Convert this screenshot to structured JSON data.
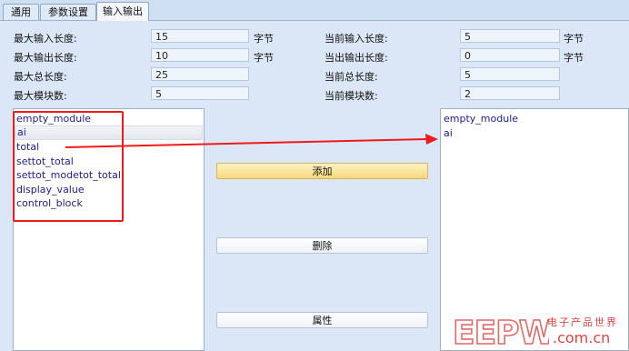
{
  "tabs": [
    {
      "label": "通用"
    },
    {
      "label": "参数设置"
    },
    {
      "label": "输入输出"
    }
  ],
  "fields": {
    "max_input_len": {
      "label": "最大输入长度:",
      "value": "15",
      "unit": "字节"
    },
    "max_output_len": {
      "label": "最大输出长度:",
      "value": "10",
      "unit": "字节"
    },
    "max_total_len": {
      "label": "最大总长度:",
      "value": "25"
    },
    "max_modules": {
      "label": "最大模块数:",
      "value": "5"
    },
    "cur_input_len": {
      "label": "当前输入长度:",
      "value": "5",
      "unit": "字节"
    },
    "cur_output_len": {
      "label": "当出输出长度:",
      "value": "0",
      "unit": "字节"
    },
    "cur_total_len": {
      "label": "当前总长度:",
      "value": "5"
    },
    "cur_modules": {
      "label": "当前模块数:",
      "value": "2"
    }
  },
  "available_modules": [
    "empty_module",
    "ai",
    "total",
    "settot_total",
    "settot_modetot_total",
    "display_value",
    "control_block"
  ],
  "selected_modules": [
    "empty_module",
    "ai"
  ],
  "buttons": {
    "add": "添加",
    "delete": "删除",
    "properties": "属性"
  },
  "watermark": {
    "brand": "EEPW",
    "cn": "电子产品世界",
    "url": ".com.cn"
  },
  "colors": {
    "annotation": "#ef1a1a",
    "accent": "#f6d97a"
  }
}
